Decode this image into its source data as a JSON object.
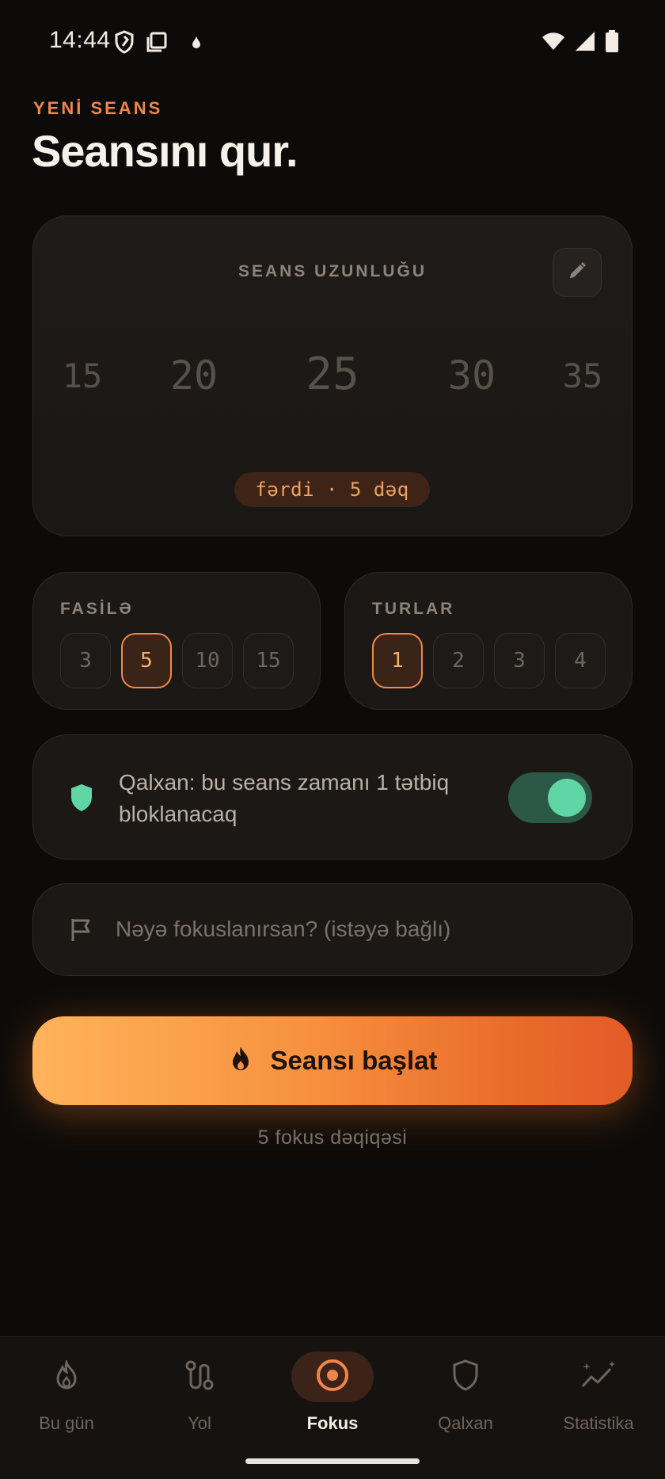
{
  "status_bar": {
    "time": "14:44",
    "left_icons": [
      "shield-outline-icon",
      "screen-icon",
      "drop-icon"
    ],
    "right_icons": [
      "wifi-icon",
      "signal-icon",
      "battery-icon"
    ]
  },
  "header": {
    "eyebrow": "YENİ SEANS",
    "title": "Seansını qur."
  },
  "length_card": {
    "label": "SEANS UZUNLUĞU",
    "wheel_values": [
      "15",
      "20",
      "25",
      "30",
      "35"
    ],
    "pill": "fərdi · 5 dəq",
    "edit_icon": "pencil-icon"
  },
  "break_card": {
    "label": "FASİLƏ",
    "options": [
      "3",
      "5",
      "10",
      "15"
    ],
    "selected": "5"
  },
  "rounds_card": {
    "label": "TURLAR",
    "options": [
      "1",
      "2",
      "3",
      "4"
    ],
    "selected": "1"
  },
  "shield_card": {
    "text": "Qalxan: bu seans zamanı 1 tətbiq bloklanacaq",
    "toggle_on": true,
    "icon": "shield-icon"
  },
  "focus_input": {
    "placeholder": "Nəyə fokuslanırsan? (istəyə bağlı)",
    "icon": "flag-icon"
  },
  "start": {
    "label": "Seansı başlat",
    "subtext": "5 fokus dəqiqəsi",
    "icon": "flame-icon"
  },
  "bottom_nav": {
    "items": [
      {
        "label": "Bu gün",
        "icon": "flame-icon"
      },
      {
        "label": "Yol",
        "icon": "route-icon"
      },
      {
        "label": "Fokus",
        "icon": "target-icon"
      },
      {
        "label": "Qalxan",
        "icon": "shield-icon"
      },
      {
        "label": "Statistika",
        "icon": "sparkle-chart-icon"
      }
    ],
    "active": "Fokus"
  },
  "colors": {
    "accent": "#f0854a",
    "background": "#0d0b09",
    "card": "#1c1815",
    "shield_green": "#5fd6a3"
  }
}
